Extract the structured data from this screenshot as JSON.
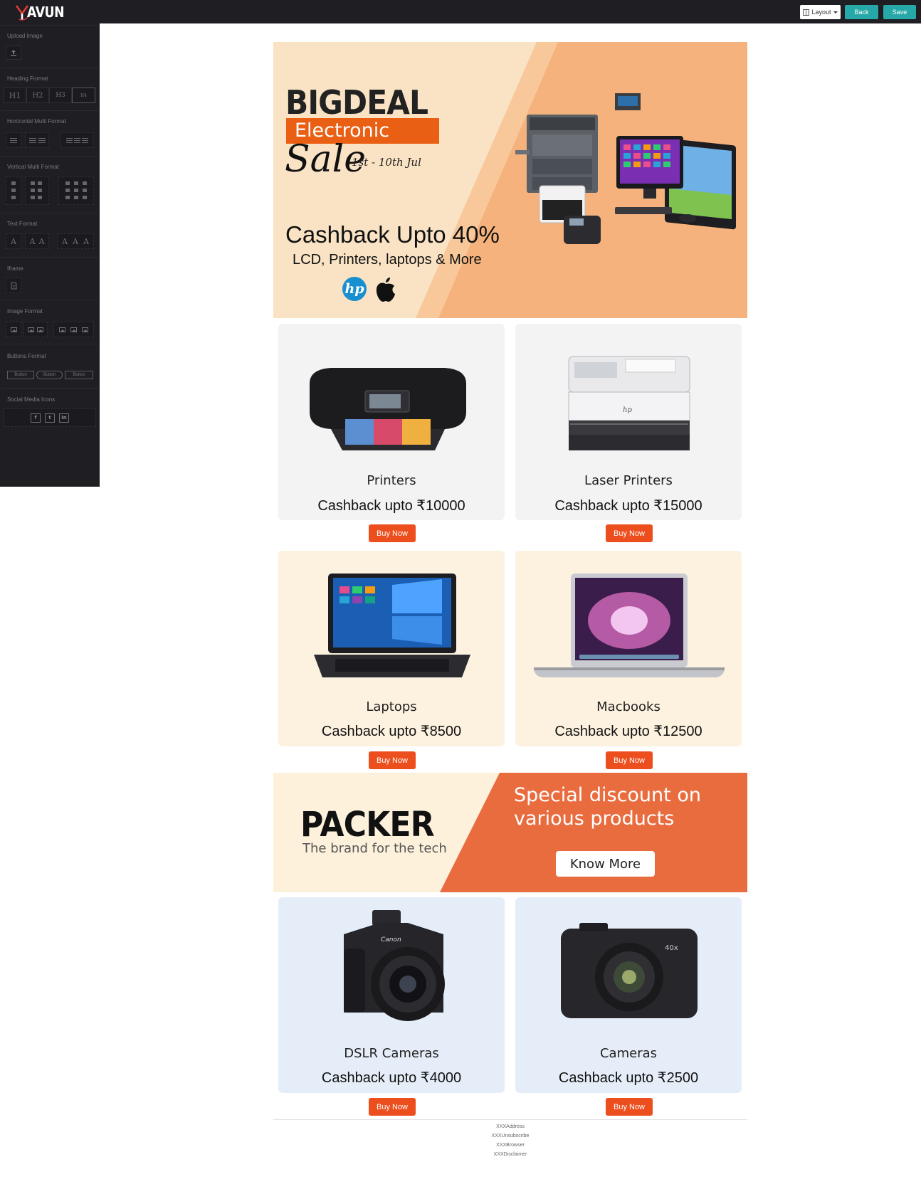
{
  "topbar": {
    "logo_text": "AVUN",
    "layout_label": "Layout",
    "back_label": "Back",
    "save_label": "Save"
  },
  "sidebar": {
    "upload_image": "Upload Image",
    "heading_format": "Heading Format",
    "heading_buttons": [
      "H1",
      "H2",
      "H3",
      "H4"
    ],
    "horizontal_multi": "Horizontal Multi Format",
    "vertical_multi": "Vertical Multi Format",
    "text_format": "Text Format",
    "text_glyphs": [
      "A",
      "A",
      "A",
      "A",
      "A",
      "A"
    ],
    "iframe": "Iframe",
    "image_format": "Image Format",
    "buttons_format": "Buttons Format",
    "button_samples": [
      "Button",
      "Button",
      "Button"
    ],
    "social_media": "Social Media Icons",
    "social_glyphs": [
      "f",
      "t",
      "in"
    ]
  },
  "hero": {
    "brand": "BIGDEAL",
    "category": "Electronic",
    "sale": "Sale",
    "dates": "1st - 10th Jul",
    "cashback": "Cashback Upto 40%",
    "subline": "LCD, Printers, laptops & More",
    "hp": "hp"
  },
  "products": [
    {
      "name": "Printers",
      "cashback": "Cashback upto ₹10000",
      "button": "Buy Now",
      "bg": "#f3f3f3"
    },
    {
      "name": "Laser Printers",
      "cashback": "Cashback upto ₹15000",
      "button": "Buy Now",
      "bg": "#f3f3f3"
    },
    {
      "name": "Laptops",
      "cashback": "Cashback upto ₹8500",
      "button": "Buy Now",
      "bg": "#fdf2e0"
    },
    {
      "name": "Macbooks",
      "cashback": "Cashback upto ₹12500",
      "button": "Buy Now",
      "bg": "#fdf2e0"
    },
    {
      "name": "DSLR Cameras",
      "cashback": "Cashback upto ₹4000",
      "button": "Buy Now",
      "bg": "#e5eef8"
    },
    {
      "name": "Cameras",
      "cashback": "Cashback upto ₹2500",
      "button": "Buy Now",
      "bg": "#e5eef8"
    }
  ],
  "packer": {
    "brand": "PACKER",
    "tagline": "The brand for the tech",
    "headline": "Special discount on various products",
    "cta": "Know More"
  },
  "footer": [
    "XXXAddress",
    "XXXUnsubscribe",
    "XXXBrowser",
    "XXXDisclaimer"
  ],
  "colors": {
    "accent": "#27a8a8",
    "buy_button": "#ec4e1e",
    "hero_orange": "#e95f14",
    "dark_panel": "#1f1e22"
  }
}
